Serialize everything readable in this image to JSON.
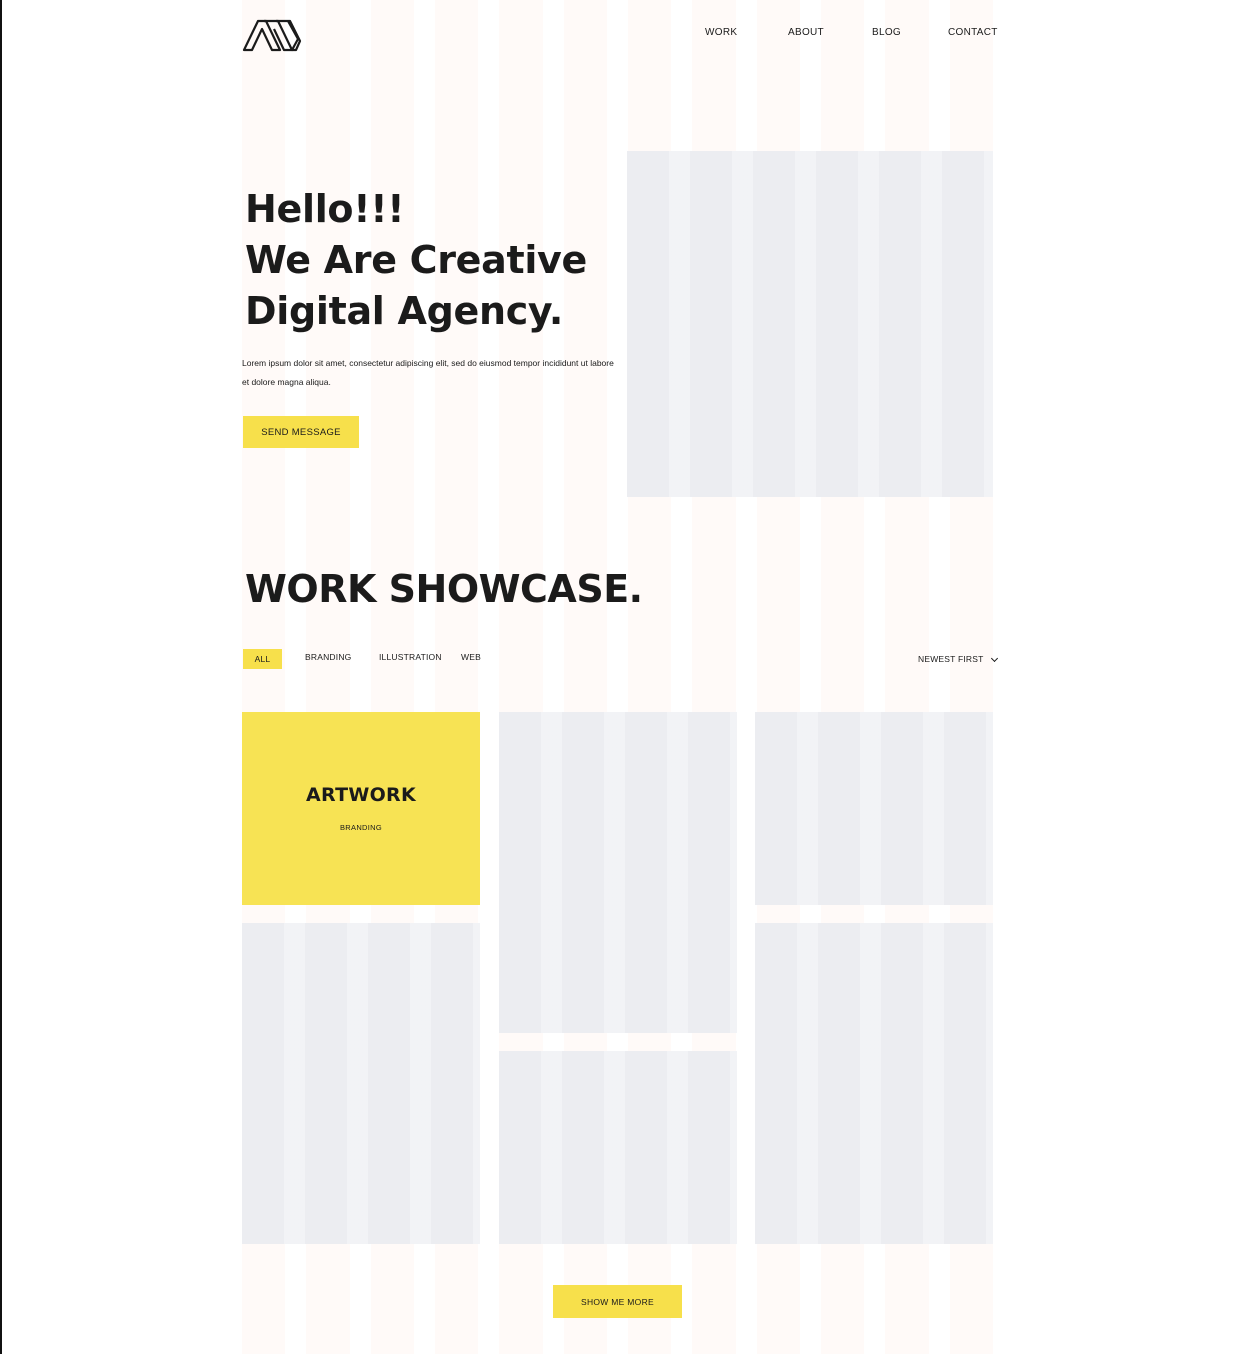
{
  "header": {
    "logo": "agency-logo-icon",
    "nav": [
      "WORK",
      "ABOUT",
      "BLOG",
      "CONTACT"
    ]
  },
  "hero": {
    "title_lines": [
      "Hello!!!",
      "We Are Creative",
      "Digital Agency."
    ],
    "text": "Lorem ipsum dolor sit amet, consectetur adipiscing elit, sed do eiusmod tempor incididunt ut labore et dolore magna aliqua.",
    "button_label": "SEND MESSAGE"
  },
  "showcase": {
    "title": "WORK SHOWCASE.",
    "filters": [
      "ALL",
      "BRANDING",
      "ILLUSTRATION",
      "WEB"
    ],
    "active_filter": "ALL",
    "sort_label": "NEWEST FIRST",
    "featured": {
      "title": "ARTWORK",
      "category": "BRANDING"
    },
    "more_button_label": "SHOW ME MORE"
  },
  "colors": {
    "accent": "#f7e04b",
    "text": "#1b1b1b",
    "placeholder": "#ecedf1"
  }
}
